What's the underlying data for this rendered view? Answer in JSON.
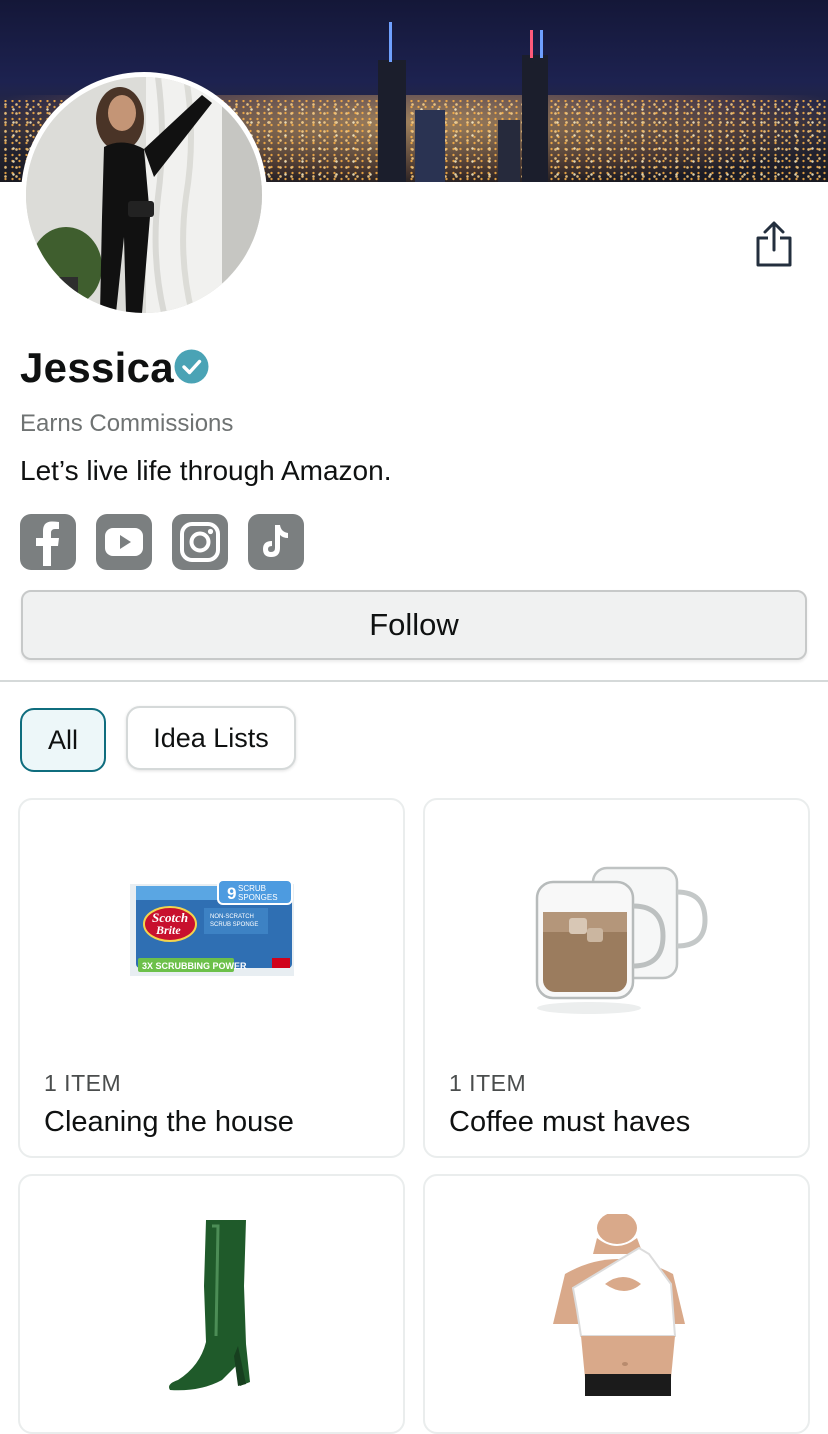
{
  "profile": {
    "name": "Jessica",
    "tagline": "Earns Commissions",
    "bio": "Let’s live life through Amazon."
  },
  "social_links": [
    {
      "icon": "facebook-icon"
    },
    {
      "icon": "youtube-icon"
    },
    {
      "icon": "instagram-icon"
    },
    {
      "icon": "tiktok-icon"
    }
  ],
  "actions": {
    "follow_label": "Follow",
    "share_icon": "share-icon"
  },
  "filters": [
    {
      "label": "All",
      "selected": true
    },
    {
      "label": "Idea Lists",
      "selected": false
    }
  ],
  "lists": [
    {
      "count": "1 ITEM",
      "title": "Cleaning the house",
      "image": "scrub-sponges"
    },
    {
      "count": "1 ITEM",
      "title": "Coffee must haves",
      "image": "glass-mugs"
    },
    {
      "count": "",
      "title": "",
      "image": "green-boot"
    },
    {
      "count": "",
      "title": "",
      "image": "white-sports-bra"
    }
  ],
  "colors": {
    "accent": "#0f6d7e",
    "verified": "#4aa3b5",
    "social_icon_bg": "#7b7f80"
  }
}
